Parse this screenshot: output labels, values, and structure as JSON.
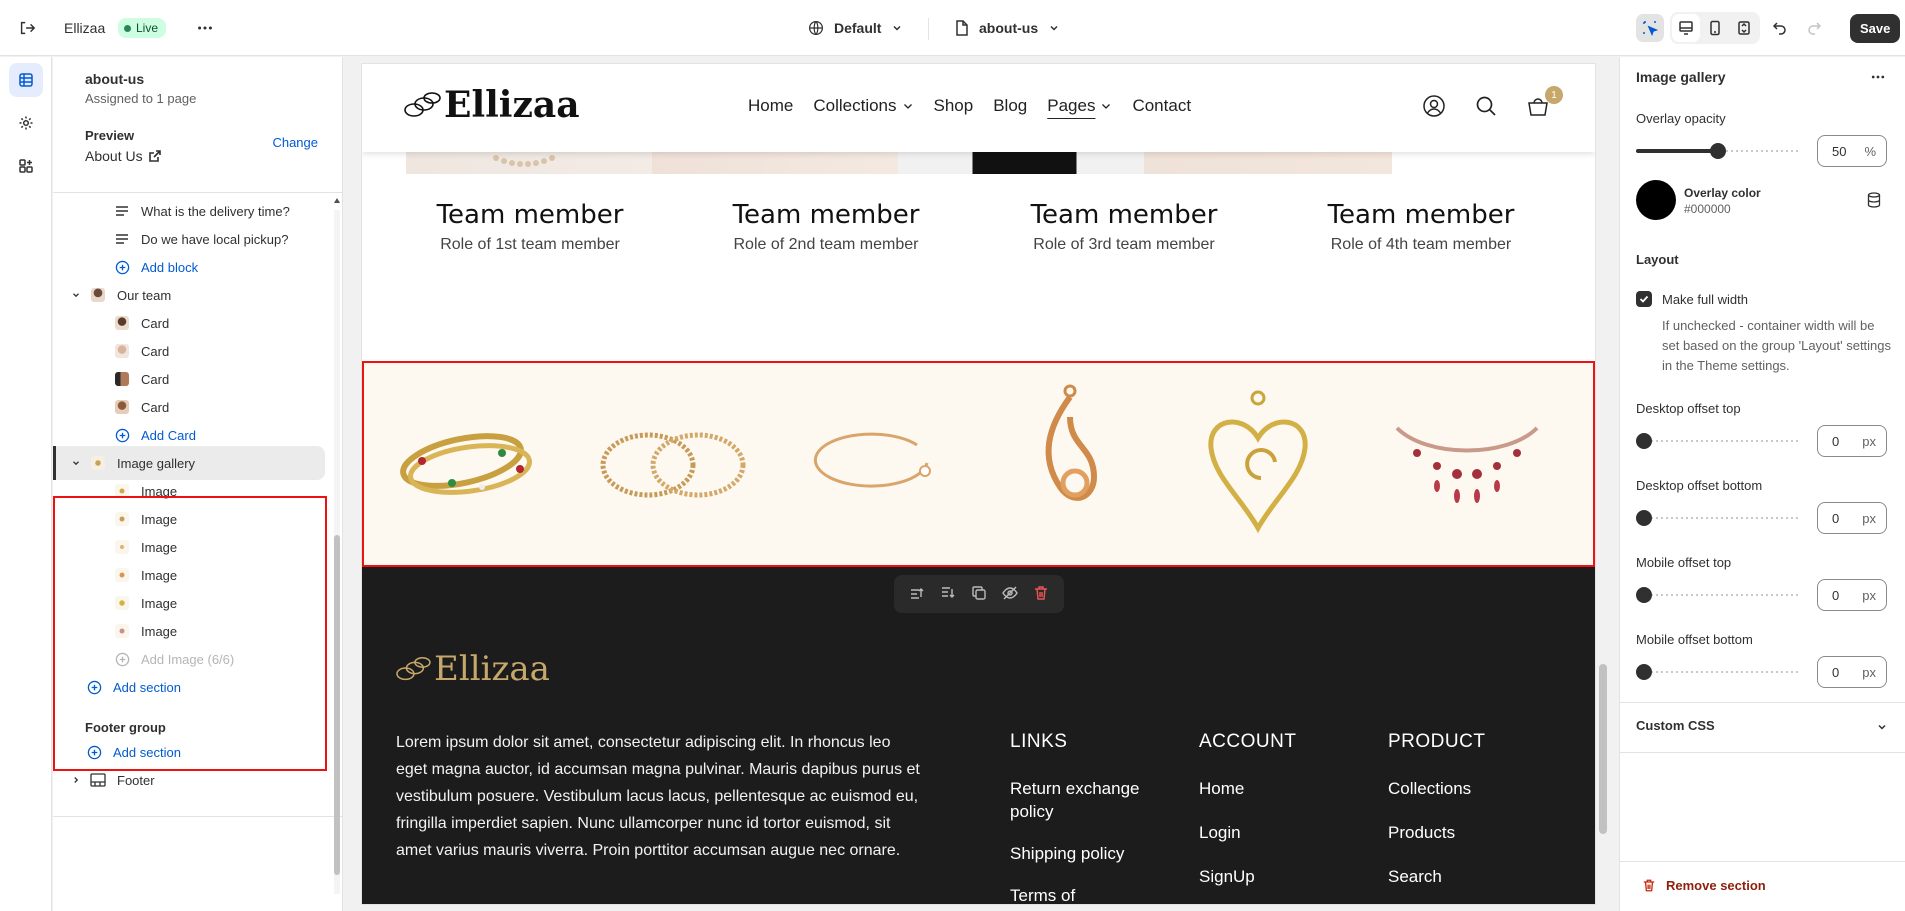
{
  "topbar": {
    "store_name": "Ellizaa",
    "status": "Live",
    "theme": "Default",
    "page": "about-us",
    "save_label": "Save"
  },
  "sidebar": {
    "page_name": "about-us",
    "assigned": "Assigned to 1 page",
    "preview_label": "Preview",
    "change_label": "Change",
    "preview_page": "About Us",
    "tree": {
      "faq_items": [
        "What is the delivery time?",
        "Do we have local pickup?"
      ],
      "add_block": "Add block",
      "our_team": "Our team",
      "cards": [
        "Card",
        "Card",
        "Card",
        "Card"
      ],
      "add_card": "Add Card",
      "image_gallery": "Image gallery",
      "images": [
        "Image",
        "Image",
        "Image",
        "Image",
        "Image",
        "Image"
      ],
      "add_image": "Add Image (6/6)",
      "add_section": "Add section",
      "footer_group": "Footer group",
      "add_section_2": "Add section",
      "footer": "Footer"
    }
  },
  "preview": {
    "logo": "Ellizaa",
    "nav": [
      "Home",
      "Collections",
      "Shop",
      "Blog",
      "Pages",
      "Contact"
    ],
    "cart_count": "1",
    "team": [
      {
        "name": "Team member",
        "role": "Role of 1st team member"
      },
      {
        "name": "Team member",
        "role": "Role of 2nd team member"
      },
      {
        "name": "Team member",
        "role": "Role of 3rd team member"
      },
      {
        "name": "Team member",
        "role": "Role of 4th team member"
      }
    ],
    "footer": {
      "logo": "Ellizaa",
      "text": "Lorem ipsum dolor sit amet, consectetur adipiscing elit. In rhoncus leo eget magna auctor, id accumsan magna pulvinar. Mauris dapibus purus et vestibulum posuere. Vestibulum lacus lacus, pellentesque ac euismod eu, fringilla imperdiet sapien. Nunc ullamcorper nunc id tortor euismod, sit amet varius mauris viverra. Proin porttitor accumsan augue nec ornare.",
      "links_title": "LINKS",
      "links": [
        "Return exchange policy",
        "Shipping policy",
        "Terms of"
      ],
      "account_title": "ACCOUNT",
      "account": [
        "Home",
        "Login",
        "SignUp"
      ],
      "product_title": "PRODUCT",
      "product": [
        "Collections",
        "Products",
        "Search"
      ]
    }
  },
  "settings": {
    "title": "Image gallery",
    "overlay_opacity_label": "Overlay opacity",
    "overlay_opacity": "50",
    "overlay_opacity_unit": "%",
    "overlay_color_label": "Overlay color",
    "overlay_color": "#000000",
    "layout_label": "Layout",
    "full_width_label": "Make full width",
    "full_width_help": "If unchecked - container width will be set based on the group 'Layout' settings in the Theme settings.",
    "desktop_top_label": "Desktop offset top",
    "desktop_top": "0",
    "desktop_bottom_label": "Desktop offset bottom",
    "desktop_bottom": "0",
    "mobile_top_label": "Mobile offset top",
    "mobile_top": "0",
    "mobile_bottom_label": "Mobile offset bottom",
    "mobile_bottom": "0",
    "unit_px": "px",
    "custom_css": "Custom CSS",
    "remove_section": "Remove section"
  },
  "colors": {
    "accent": "#005bd3",
    "gold": "#c7a86b",
    "danger": "#e11111"
  }
}
